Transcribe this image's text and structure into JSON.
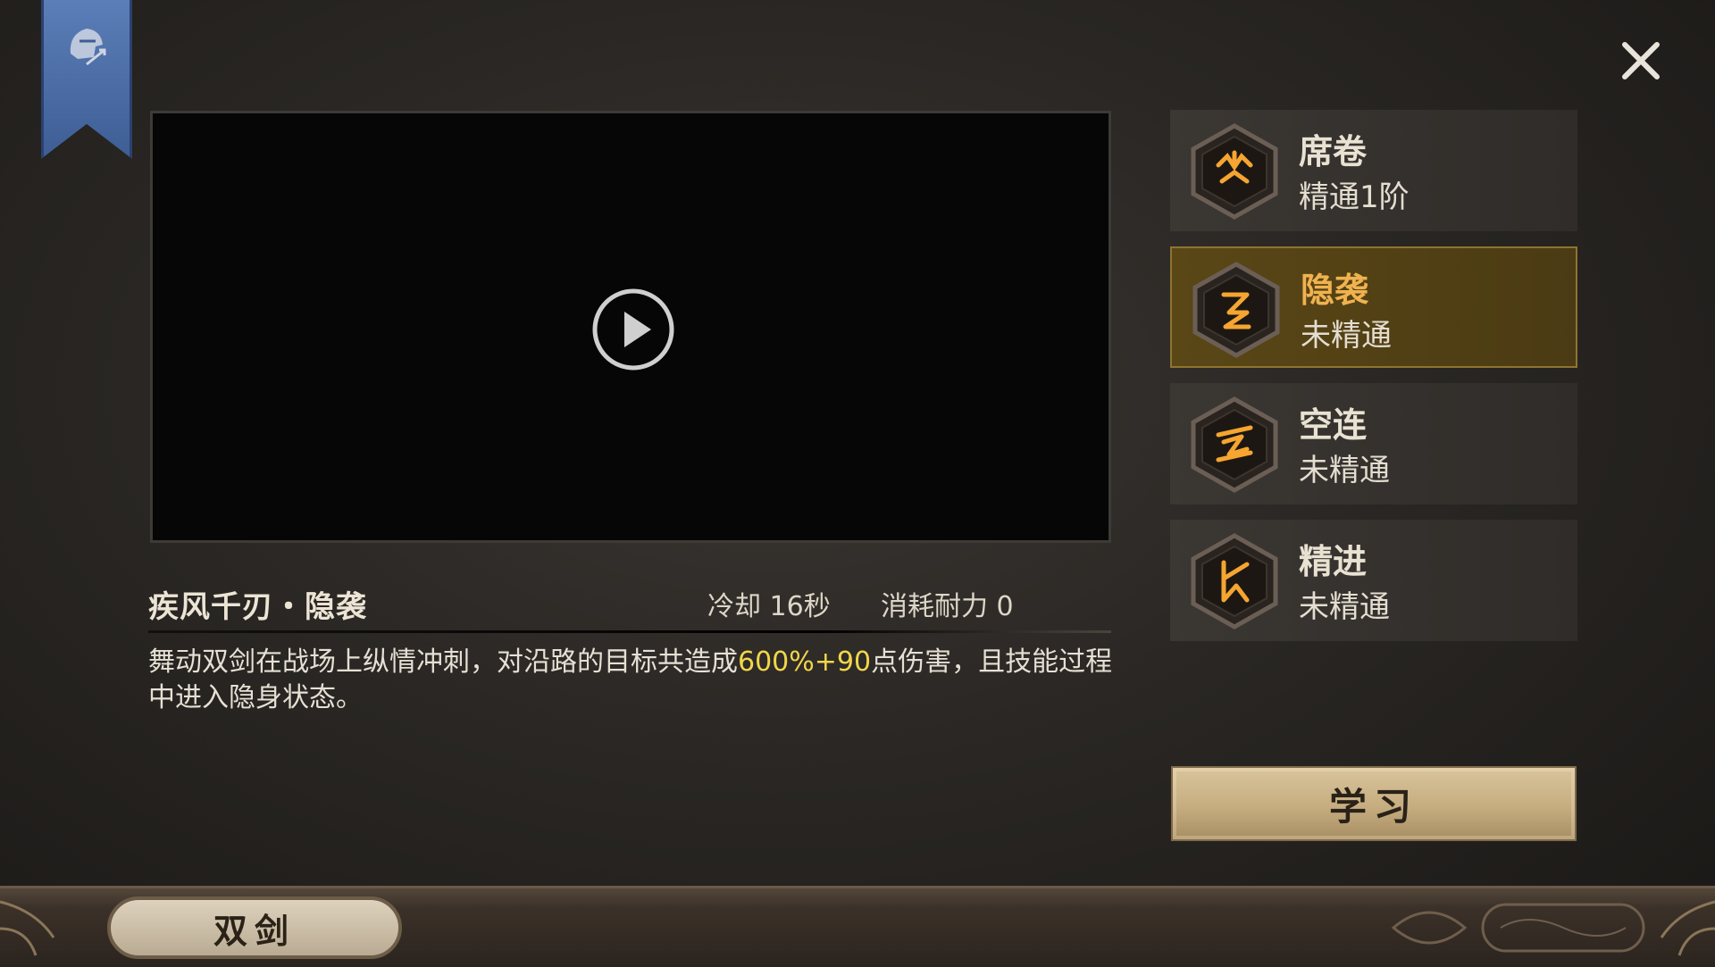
{
  "header": {
    "banner_icon": "knight-helmet-icon",
    "close_icon": "close-icon"
  },
  "video": {
    "play_icon": "play-icon"
  },
  "skill": {
    "title": "疾风千刃・隐袭",
    "cooldown": "冷却 16秒",
    "cost": "消耗耐力 0",
    "description_before": "舞动双剑在战场上纵情冲刺，对沿路的目标共造成",
    "description_highlight": "600%+90",
    "description_after": "点伤害，且技能过程中进入隐身状态。"
  },
  "skill_list": [
    {
      "name": "席卷",
      "status": "精通1阶",
      "active": false,
      "icon": "rune-sweep-icon"
    },
    {
      "name": "隐袭",
      "status": "未精通",
      "active": true,
      "icon": "rune-stealth-icon"
    },
    {
      "name": "空连",
      "status": "未精通",
      "active": false,
      "icon": "rune-aerial-icon"
    },
    {
      "name": "精进",
      "status": "未精通",
      "active": false,
      "icon": "rune-advance-icon"
    }
  ],
  "learn_button": "学习",
  "weapon_tab": "双剑",
  "colors": {
    "highlight": "#f1d64a",
    "active_name": "#f0b24f",
    "banner": "#4f70aa",
    "active_bg": "#54421a"
  }
}
